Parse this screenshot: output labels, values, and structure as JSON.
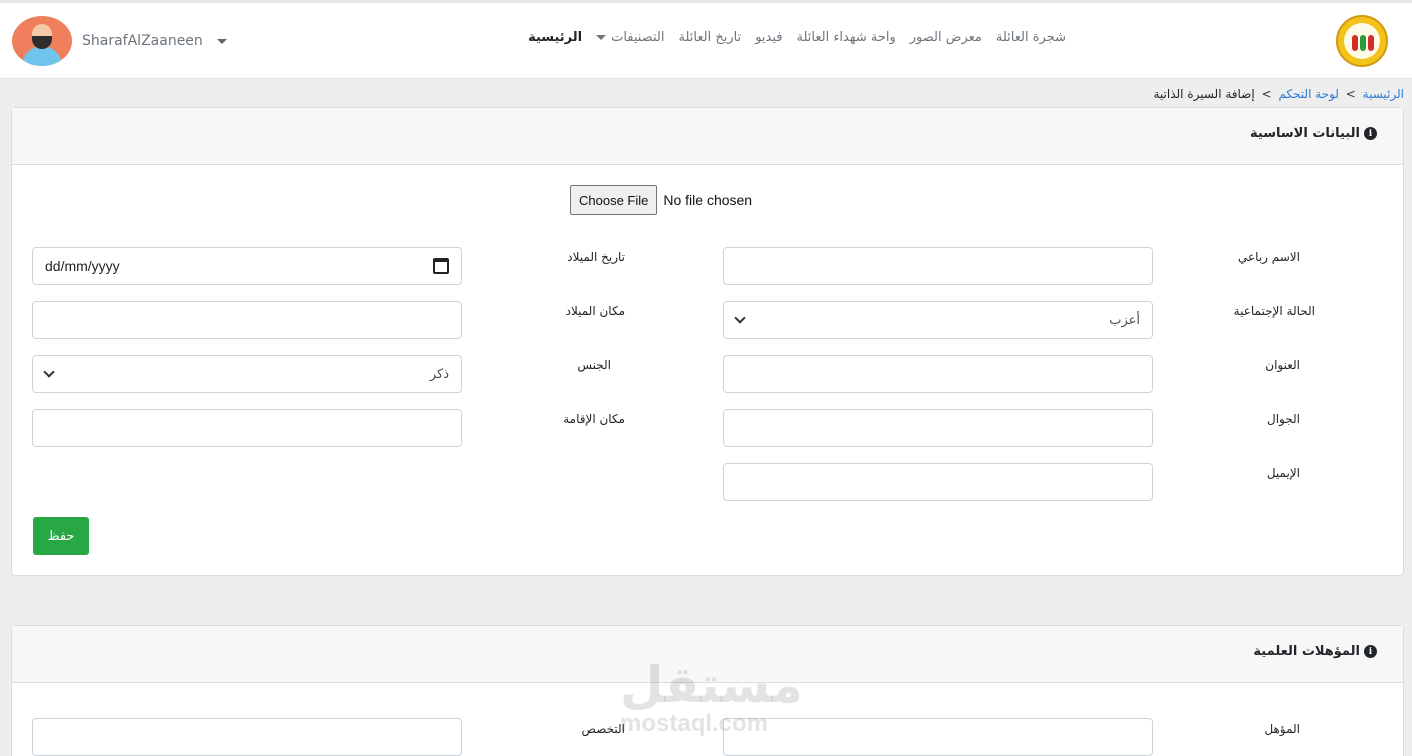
{
  "colors": {
    "accent": "#28a745",
    "link": "#2b7bd3",
    "brand_logo": "#f3c21b"
  },
  "nav": {
    "items": [
      {
        "label": "الرئيسية",
        "active": true
      },
      {
        "label": "التصنيفات",
        "dropdown": true
      },
      {
        "label": "تاريخ العائلة"
      },
      {
        "label": "فيديو"
      },
      {
        "label": "واحة شهداء العائلة"
      },
      {
        "label": "معرض الصور"
      },
      {
        "label": "شجرة العائلة"
      }
    ],
    "user_name": "SharafAlZaaneen"
  },
  "breadcrumb": {
    "home": "الرئيسية",
    "sep": ">",
    "dashboard": "لوحة التحكم",
    "current": "إضافة السيرة الذاتية"
  },
  "basic_info": {
    "title": "البيانات الاساسية",
    "file_button": "Choose File",
    "file_status": "No file chosen",
    "labels": {
      "full_name": "الاسم رباعي",
      "marital": "الحالة الإجتماعية",
      "address": "العنوان",
      "mobile": "الجوال",
      "email": "الإيميل",
      "birth_date": "تاريخ الميلاد",
      "birth_place": "مكان الميلاد",
      "gender": "الجنس",
      "residence": "مكان الإقامة"
    },
    "values": {
      "marital": "أعزب",
      "gender": "ذكر",
      "birth_date_placeholder": "dd/mm/yyyy"
    },
    "save_label": "حفظ"
  },
  "qualifications": {
    "title": "المؤهلات العلمية",
    "labels": {
      "qualification": "المؤهل",
      "specialization": "التخصص"
    }
  },
  "watermark": {
    "ar": "مستقل",
    "en": "mostaql.com"
  }
}
